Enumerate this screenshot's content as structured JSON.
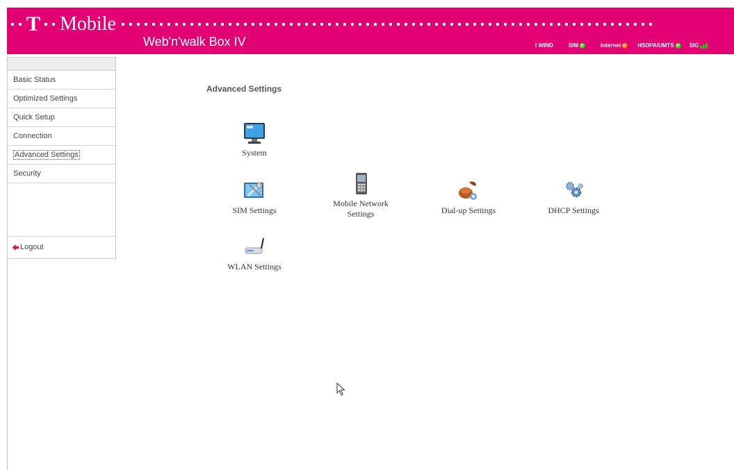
{
  "header": {
    "brand_t": "T",
    "brand_name": "Mobile",
    "product": "Web'n'walk Box IV",
    "status": {
      "operator": "I WIND",
      "sim_label": "SIM",
      "internet_label": "Internet",
      "network_label": "HSDPA/UMTS",
      "sig_label": "SIG"
    },
    "colors": {
      "brand": "#e20074",
      "ok": "#2fbf1a",
      "warn": "#ff6a00"
    }
  },
  "sidebar": {
    "items": [
      {
        "label": "Basic Status"
      },
      {
        "label": "Optimized Settings"
      },
      {
        "label": "Quick Setup"
      },
      {
        "label": "Connection"
      },
      {
        "label": "Advanced Settings"
      },
      {
        "label": "Security"
      }
    ],
    "logout": "Logout"
  },
  "main": {
    "title": "Advanced Settings",
    "settings": [
      {
        "label": "System",
        "icon": "monitor-icon"
      },
      {
        "label": "SIM Settings",
        "icon": "sim-tools-icon"
      },
      {
        "label": "Mobile Network Settings",
        "icon": "mobile-phone-icon"
      },
      {
        "label": "Dial-up Settings",
        "icon": "dialup-gear-icon"
      },
      {
        "label": "DHCP Settings",
        "icon": "gears-icon"
      },
      {
        "label": "WLAN Settings",
        "icon": "router-icon"
      }
    ]
  }
}
